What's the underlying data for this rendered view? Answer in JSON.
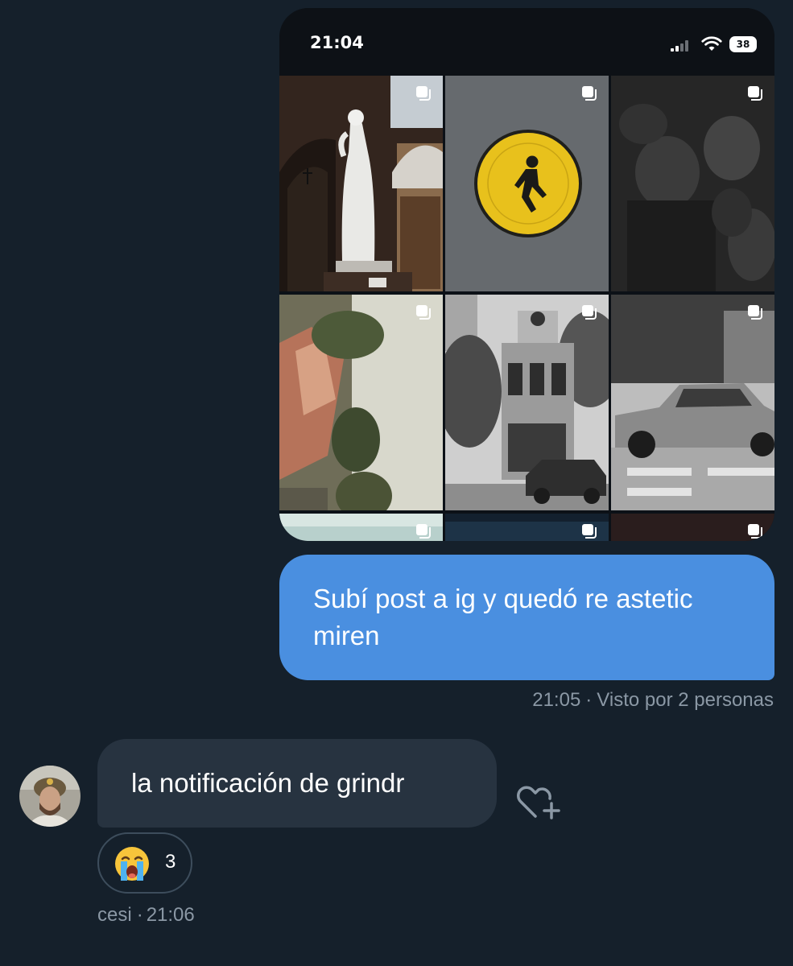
{
  "screenshot": {
    "time": "21:04",
    "battery": "38",
    "tiles": [
      {
        "name": "statue-photo"
      },
      {
        "name": "pedestrian-sign-photo"
      },
      {
        "name": "crowd-photo"
      },
      {
        "name": "rooftops-photo"
      },
      {
        "name": "corner-building-photo"
      },
      {
        "name": "car-photo"
      }
    ]
  },
  "sent_message": {
    "text": "Subí post a ig y quedó re astetic miren",
    "time": "21:05",
    "seen": "Visto por 2 personas"
  },
  "received_message": {
    "text": "la notificación de grindr",
    "sender": "cesi",
    "time": "21:06",
    "reaction": {
      "emoji_icon": "loudly-crying-face-icon",
      "count": "3"
    }
  },
  "separator": "·",
  "colors": {
    "background": "#15202b",
    "sent_bubble": "#4a8fe0",
    "received_bubble": "#273340",
    "meta_text": "#8b98a5"
  }
}
